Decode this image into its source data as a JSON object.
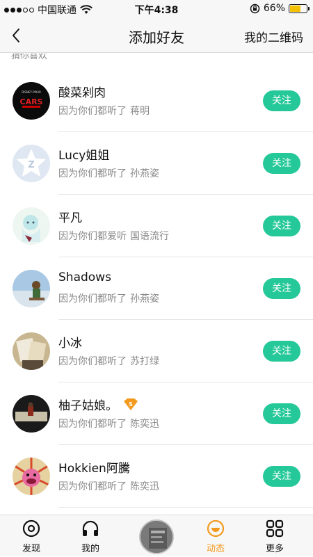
{
  "status": {
    "carrier": "中国联通",
    "time": "下午4:38",
    "battery": "66%",
    "battery_level": 0.66
  },
  "nav": {
    "title": "添加好友",
    "qr_label": "我的二维码"
  },
  "section_cut": "猜你喜欢",
  "follow_label": "关注",
  "friends": [
    {
      "name": "酸菜剁肉",
      "reason": "因为你们都听了",
      "artist": "蒋明"
    },
    {
      "name": "Lucy姐姐",
      "reason": "因为你们都听了",
      "artist": "孙燕姿"
    },
    {
      "name": "平凡",
      "reason": "因为你们都爱听",
      "artist": "国语流行"
    },
    {
      "name": "Shadows",
      "reason": "因为你们都听了",
      "artist": "孙燕姿"
    },
    {
      "name": "小冰",
      "reason": "因为你们都听了",
      "artist": "苏打绿"
    },
    {
      "name": "柚子姑娘。",
      "reason": "因为你们都听了",
      "artist": "陈奕迅",
      "badge": "S"
    },
    {
      "name": "Hokkien阿騰",
      "reason": "因为你们都听了",
      "artist": "陈奕迅"
    }
  ],
  "tabs": [
    {
      "label": "发现",
      "icon": "discover-icon"
    },
    {
      "label": "我的",
      "icon": "headphones-icon"
    },
    {
      "label": "动态",
      "icon": "feed-icon",
      "active": true
    },
    {
      "label": "更多",
      "icon": "grid-icon"
    }
  ],
  "colors": {
    "accent": "#25c898",
    "active_tab": "#f39a1e",
    "battery": "#f4c100"
  }
}
